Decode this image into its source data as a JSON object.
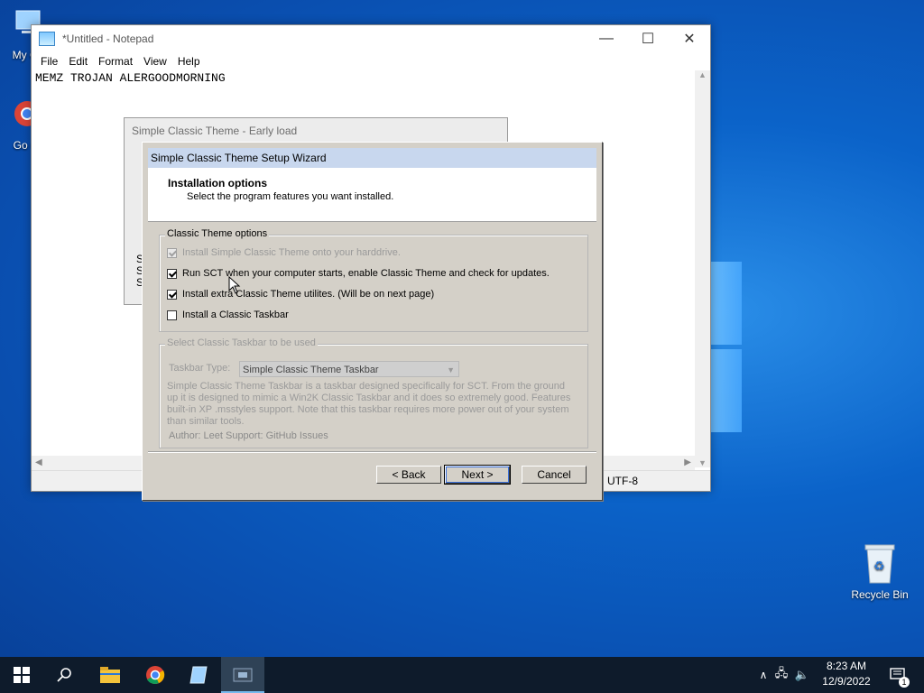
{
  "desktop": {
    "icons": [
      {
        "label": "My Co"
      },
      {
        "label": "Go Ch"
      },
      {
        "label": "Recycle Bin"
      }
    ]
  },
  "notepad": {
    "title": "*Untitled - Notepad",
    "menu": [
      "File",
      "Edit",
      "Format",
      "View",
      "Help"
    ],
    "content": "MEMZ TROJAN ALERGOODMORNING",
    "encoding": "UTF-8"
  },
  "early_load": {
    "title": "Simple Classic Theme - Early load",
    "side_text": "S\nS\nS"
  },
  "wizard": {
    "title": "Simple Classic Theme Setup Wizard",
    "header_title": "Installation options",
    "header_subtitle": "Select the program features you want installed.",
    "options_group": {
      "legend": "Classic Theme options",
      "items": [
        {
          "label": "Install Simple Classic Theme onto your harddrive.",
          "checked": true,
          "enabled": false
        },
        {
          "label": "Run SCT when your computer starts, enable Classic Theme and check for updates.",
          "checked": true,
          "enabled": true
        },
        {
          "label": "Install extra Classic Theme utilites. (Will be on next page)",
          "checked": true,
          "enabled": true
        },
        {
          "label": "Install a Classic Taskbar",
          "checked": false,
          "enabled": true
        }
      ]
    },
    "taskbar_group": {
      "legend": "Select Classic Taskbar to be used",
      "type_label": "Taskbar Type:",
      "type_value": "Simple Classic Theme Taskbar",
      "description": "Simple Classic Theme Taskbar is a taskbar designed specifically for SCT. From the ground up it is designed to mimic a Win2K Classic Taskbar and it does so extremely good. Features built-in XP .msstyles support. Note that this taskbar requires more power out of your system than similar tools.",
      "author": "Author: Leet Support: GitHub Issues"
    },
    "buttons": {
      "back": "< Back",
      "next": "Next >",
      "cancel": "Cancel"
    }
  },
  "taskbar": {
    "time": "8:23 AM",
    "date": "12/9/2022",
    "notification_count": "1"
  }
}
